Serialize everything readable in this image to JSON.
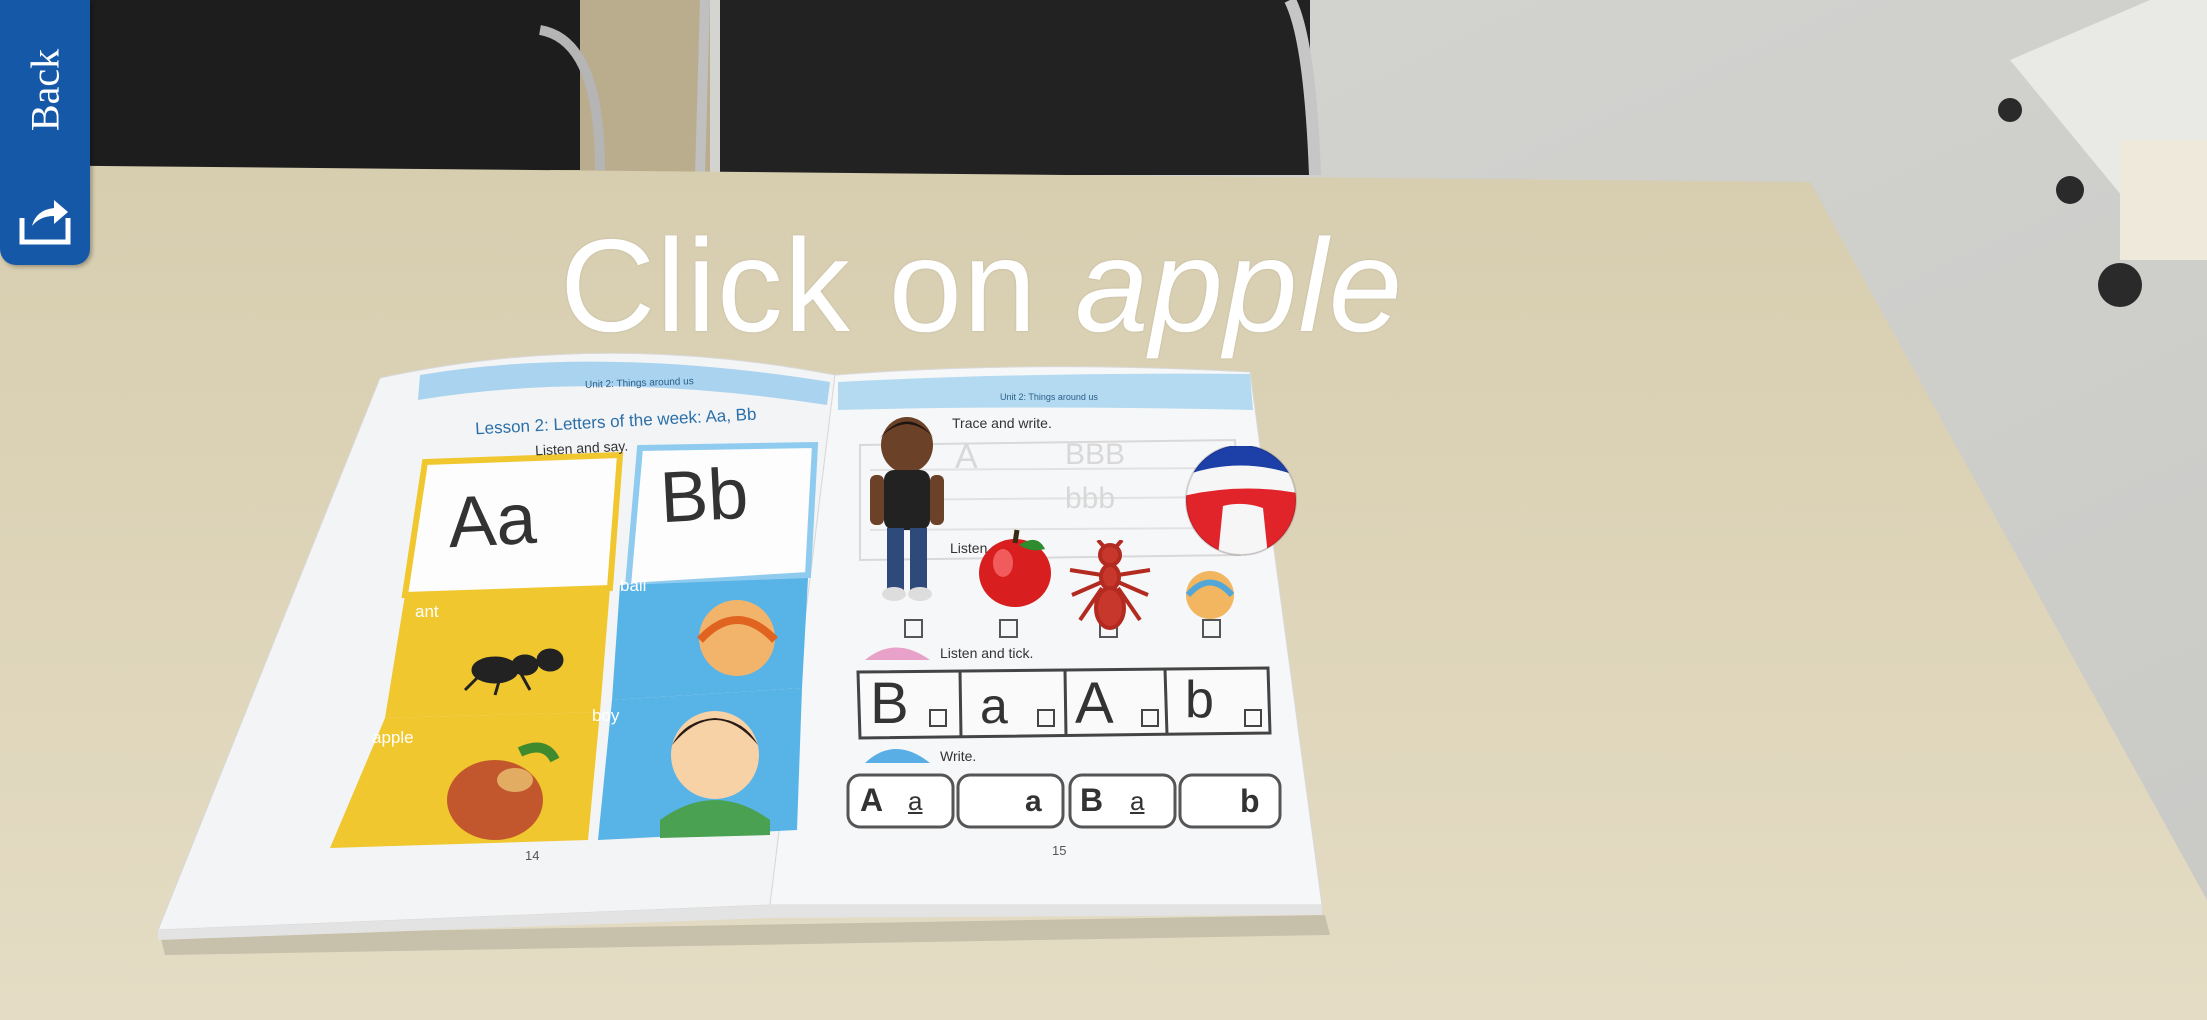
{
  "back_button": {
    "label": "Back",
    "icon": "back-share-icon"
  },
  "instruction": {
    "prefix": "Click on",
    "target": "apple"
  },
  "book": {
    "left_page": {
      "unit_header": "Unit 2: Things around us",
      "lesson_title": "Lesson 2: Letters of the week: Aa, Bb",
      "activity": "Listen and say.",
      "letters_a": "Aa",
      "letters_b": "Bb",
      "words": [
        "ant",
        "ball",
        "apple",
        "boy"
      ],
      "page_number": "14"
    },
    "right_page": {
      "unit_header": "Unit 2: Things around us",
      "trace_heading": "Trace and write.",
      "trace_a": "A",
      "trace_b1": "BBB",
      "trace_b2": "bbb",
      "listen_circle_heading": "Listen and tick.",
      "listen_tick_heading": "Listen and tick.",
      "tick_letters": [
        "B",
        "a",
        "A",
        "b"
      ],
      "write_heading": "Write.",
      "write_boxes": [
        {
          "left": "A",
          "right": "a"
        },
        {
          "left": "",
          "right": "a"
        },
        {
          "left": "B",
          "right": "a"
        },
        {
          "left": "",
          "right": "b"
        }
      ],
      "page_number": "15"
    }
  },
  "ar_objects": [
    "boy-character",
    "apple",
    "ant",
    "ball"
  ]
}
